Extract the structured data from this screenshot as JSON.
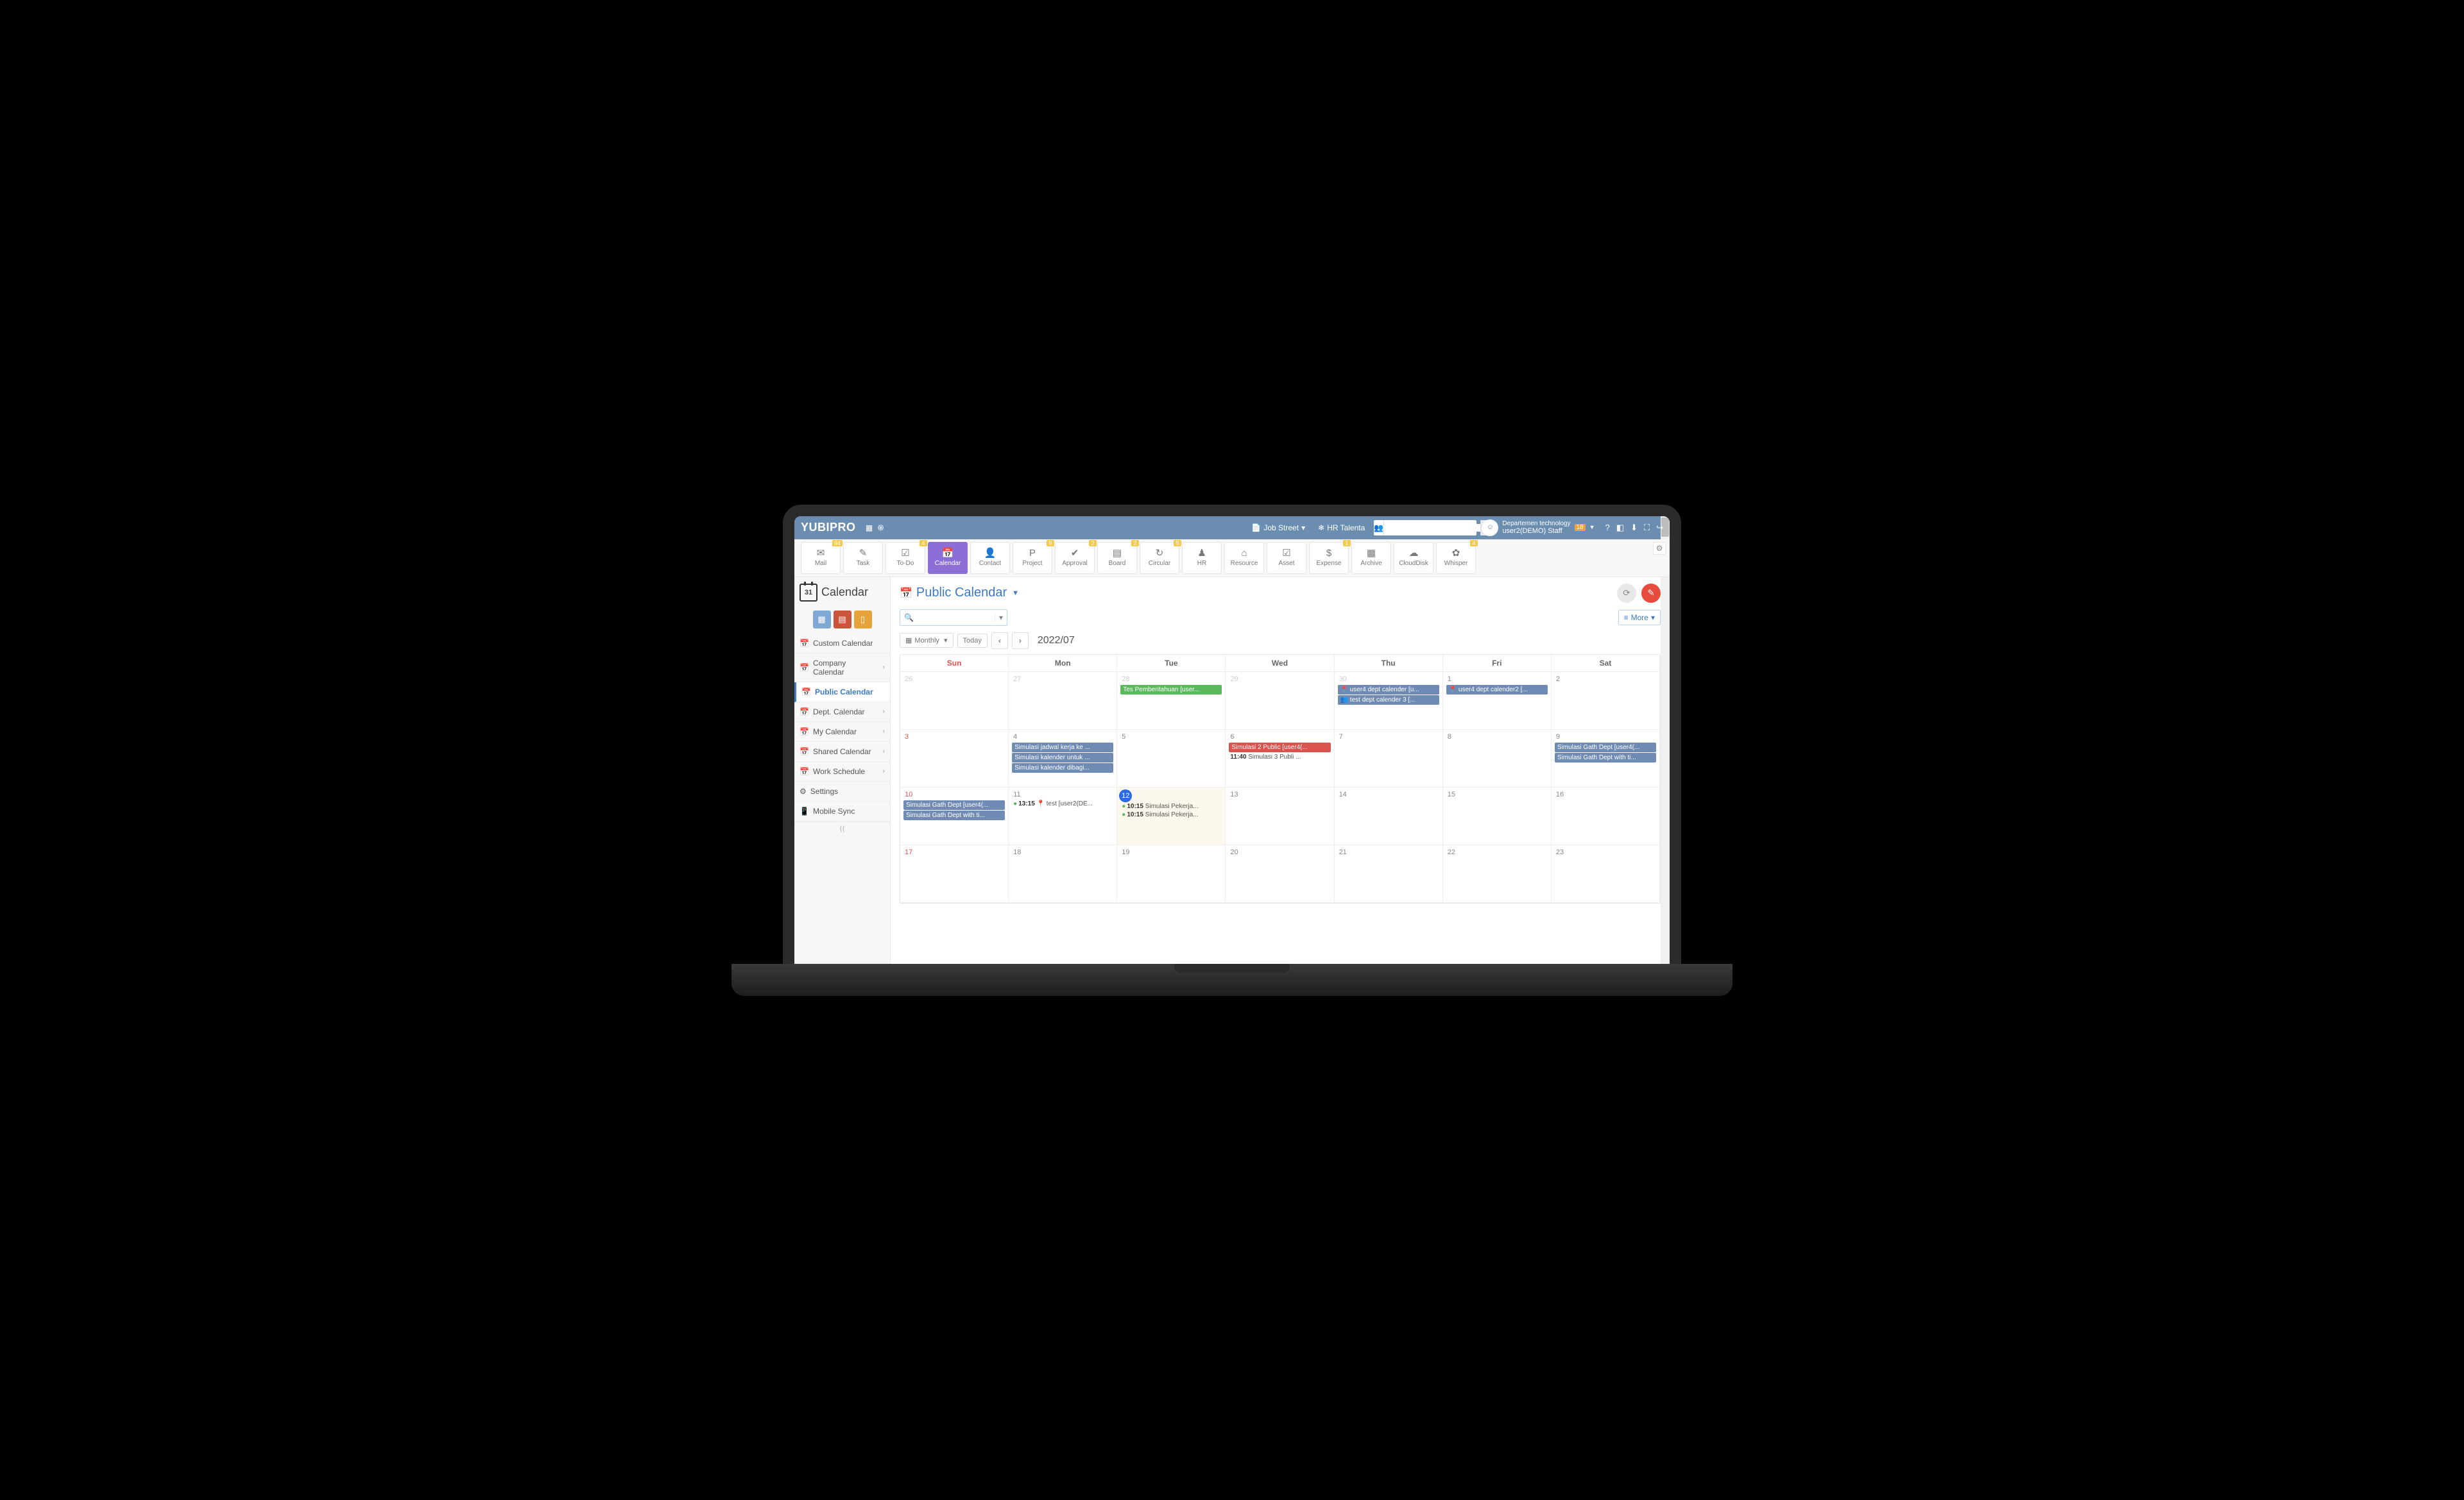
{
  "brand": "YUBIPRO",
  "top": {
    "job": "Job Street",
    "hr": "HR Talenta",
    "user_dept": "Departemen technology",
    "user_name": "user2(DEMO) Staff",
    "notif_badge": "18"
  },
  "nav": {
    "items": [
      {
        "label": "Mail",
        "icon": "✉",
        "badge": "94"
      },
      {
        "label": "Task",
        "icon": "✎",
        "badge": ""
      },
      {
        "label": "To-Do",
        "icon": "☑",
        "badge": "4"
      },
      {
        "label": "Calendar",
        "icon": "📅",
        "badge": "",
        "active": true
      },
      {
        "label": "Contact",
        "icon": "👤",
        "badge": ""
      },
      {
        "label": "Project",
        "icon": "P",
        "badge": "9"
      },
      {
        "label": "Approval",
        "icon": "✔",
        "badge": "2"
      },
      {
        "label": "Board",
        "icon": "▤",
        "badge": "2"
      },
      {
        "label": "Circular",
        "icon": "↻",
        "badge": "5"
      },
      {
        "label": "HR",
        "icon": "♟",
        "badge": ""
      },
      {
        "label": "Resource",
        "icon": "⌂",
        "badge": ""
      },
      {
        "label": "Asset",
        "icon": "☑",
        "badge": ""
      },
      {
        "label": "Expense",
        "icon": "$",
        "badge": "1"
      },
      {
        "label": "Archive",
        "icon": "▦",
        "badge": ""
      },
      {
        "label": "CloudDisk",
        "icon": "☁",
        "badge": ""
      },
      {
        "label": "Whisper",
        "icon": "✿",
        "badge": "4"
      }
    ]
  },
  "sidebar": {
    "title": "Calendar",
    "day": "31",
    "items": [
      {
        "label": "Custom Calendar",
        "chev": false
      },
      {
        "label": "Company Calendar",
        "chev": true
      },
      {
        "label": "Public Calendar",
        "chev": false,
        "active": true
      },
      {
        "label": "Dept. Calendar",
        "chev": true
      },
      {
        "label": "My Calendar",
        "chev": true
      },
      {
        "label": "Shared Calendar",
        "chev": true
      },
      {
        "label": "Work Schedule",
        "chev": true
      },
      {
        "label": "Settings",
        "chev": false,
        "icon": "gear"
      },
      {
        "label": "Mobile Sync",
        "chev": false,
        "icon": "mobile"
      }
    ]
  },
  "page": {
    "title": "Public Calendar",
    "more": "More",
    "view": "Monthly",
    "today": "Today",
    "current": "2022/07"
  },
  "dayhead": [
    "Sun",
    "Mon",
    "Tue",
    "Wed",
    "Thu",
    "Fri",
    "Sat"
  ],
  "weeks": [
    [
      {
        "n": "26",
        "other": true
      },
      {
        "n": "27",
        "other": true
      },
      {
        "n": "28",
        "other": true,
        "events": [
          {
            "t": "Tes Pemberitahuan [user...",
            "c": "green"
          }
        ]
      },
      {
        "n": "29",
        "other": true
      },
      {
        "n": "30",
        "other": true,
        "events": [
          {
            "t": "📍 user4 dept calender [u...",
            "c": "blue"
          },
          {
            "t": "👥 test dept calender 3 [...",
            "c": "blue"
          }
        ]
      },
      {
        "n": "1",
        "events": [
          {
            "t": "📍 user4 dept calender2 [...",
            "c": "blue"
          }
        ]
      },
      {
        "n": "2"
      }
    ],
    [
      {
        "n": "3",
        "sun": true
      },
      {
        "n": "4",
        "events": [
          {
            "t": "Simulasi jadwal kerja ke ...",
            "c": "blue"
          },
          {
            "t": "Simulasi kalender untuk ...",
            "c": "blue"
          },
          {
            "t": "Simulasi kalender dibagi...",
            "c": "blue"
          }
        ]
      },
      {
        "n": "5"
      },
      {
        "n": "6",
        "events": [
          {
            "t": "Simulasi 2 Public [user4(...",
            "c": "red"
          }
        ],
        "lines": [
          {
            "time": "11:40",
            "t": "Simulasi 3 Publi ..."
          }
        ]
      },
      {
        "n": "7"
      },
      {
        "n": "8"
      },
      {
        "n": "9",
        "events": [
          {
            "t": "Simulasi Gath Dept [user4(...",
            "c": "blue"
          },
          {
            "t": "Simulasi Gath Dept with ti...",
            "c": "blue"
          }
        ]
      }
    ],
    [
      {
        "n": "10",
        "sun": true,
        "events": [
          {
            "t": "Simulasi Gath Dept [user4(...",
            "c": "blue"
          },
          {
            "t": "Simulasi Gath Dept with ti...",
            "c": "blue"
          }
        ]
      },
      {
        "n": "11",
        "lines": [
          {
            "time": "13:15",
            "t": "📍 test [user2(DE...",
            "dot": true
          }
        ]
      },
      {
        "n": "12",
        "today": true,
        "lines": [
          {
            "time": "10:15",
            "t": "Simulasi Pekerja...",
            "dot": true
          },
          {
            "time": "10:15",
            "t": "Simulasi Pekerja...",
            "dot": true
          }
        ]
      },
      {
        "n": "13"
      },
      {
        "n": "14"
      },
      {
        "n": "15"
      },
      {
        "n": "16"
      }
    ],
    [
      {
        "n": "17",
        "sun": true
      },
      {
        "n": "18"
      },
      {
        "n": "19"
      },
      {
        "n": "20"
      },
      {
        "n": "21"
      },
      {
        "n": "22"
      },
      {
        "n": "23"
      }
    ]
  ]
}
